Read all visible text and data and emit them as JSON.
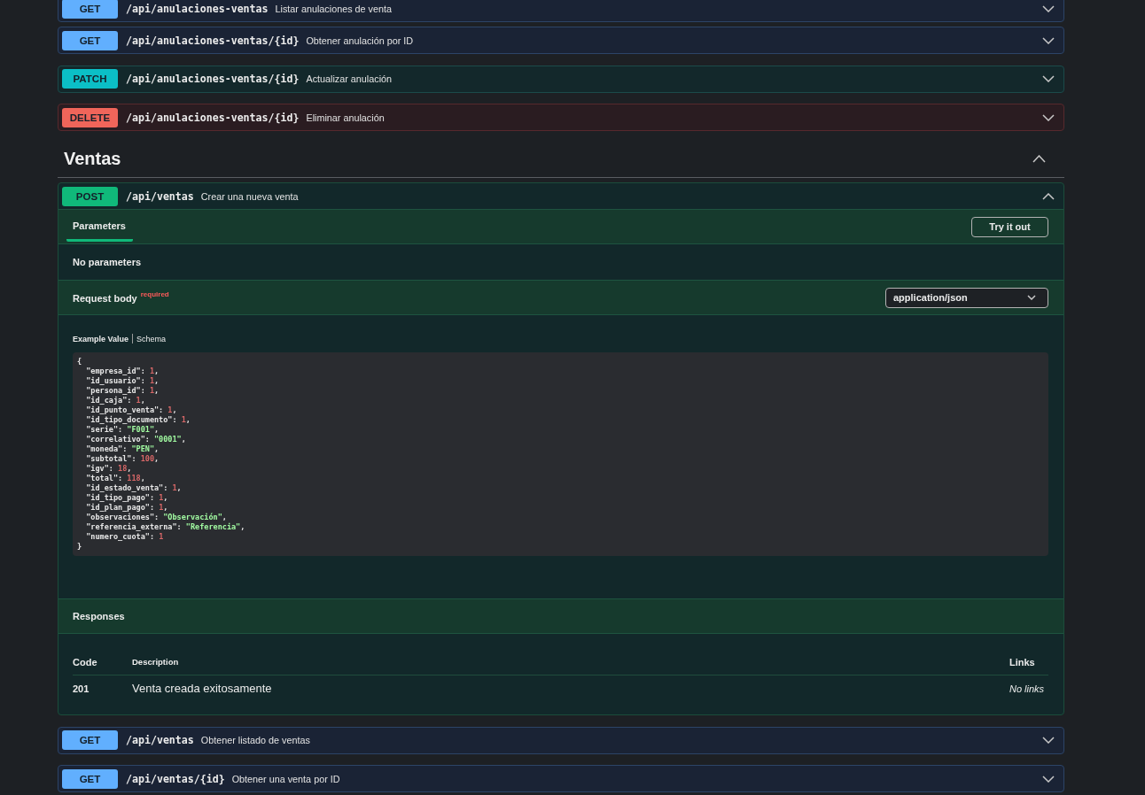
{
  "endpoints_above": [
    {
      "kind": "get",
      "method": "GET",
      "path": "/api/anulaciones-ventas",
      "summary": "Listar anulaciones de venta",
      "expanded": false
    },
    {
      "kind": "get",
      "method": "GET",
      "path": "/api/anulaciones-ventas/{id}",
      "summary": "Obtener anulación por ID",
      "expanded": false
    },
    {
      "kind": "patch",
      "method": "PATCH",
      "path": "/api/anulaciones-ventas/{id}",
      "summary": "Actualizar anulación",
      "expanded": false
    },
    {
      "kind": "delete",
      "method": "DELETE",
      "path": "/api/anulaciones-ventas/{id}",
      "summary": "Eliminar anulación",
      "expanded": false
    }
  ],
  "section": {
    "title": "Ventas",
    "expanded": true
  },
  "endpoints": [
    {
      "kind": "post",
      "method": "POST",
      "path": "/api/ventas",
      "summary": "Crear una nueva venta",
      "expanded": true,
      "details": {
        "parameters_tab": {
          "label": "Parameters",
          "selected": true
        },
        "try_it_out": "Try it out",
        "no_parameters": "No parameters",
        "request_body": {
          "label": "Request body",
          "required": "required",
          "content_type": "application/json"
        },
        "example_tabs": [
          {
            "label": "Example Value",
            "selected": true
          },
          {
            "label": "Schema",
            "selected": false
          }
        ],
        "example_lines": [
          [
            {
              "text": "{",
              "kind": "plain"
            }
          ],
          [
            {
              "text": "  \"empresa_id\": ",
              "kind": "plain"
            },
            {
              "text": "1",
              "kind": "number"
            },
            {
              "text": ",",
              "kind": "plain"
            }
          ],
          [
            {
              "text": "  \"id_usuario\": ",
              "kind": "plain"
            },
            {
              "text": "1",
              "kind": "number"
            },
            {
              "text": ",",
              "kind": "plain"
            }
          ],
          [
            {
              "text": "  \"persona_id\": ",
              "kind": "plain"
            },
            {
              "text": "1",
              "kind": "number"
            },
            {
              "text": ",",
              "kind": "plain"
            }
          ],
          [
            {
              "text": "  \"id_caja\": ",
              "kind": "plain"
            },
            {
              "text": "1",
              "kind": "number"
            },
            {
              "text": ",",
              "kind": "plain"
            }
          ],
          [
            {
              "text": "  \"id_punto_venta\": ",
              "kind": "plain"
            },
            {
              "text": "1",
              "kind": "number"
            },
            {
              "text": ",",
              "kind": "plain"
            }
          ],
          [
            {
              "text": "  \"id_tipo_documento\": ",
              "kind": "plain"
            },
            {
              "text": "1",
              "kind": "number"
            },
            {
              "text": ",",
              "kind": "plain"
            }
          ],
          [
            {
              "text": "  \"serie\": ",
              "kind": "plain"
            },
            {
              "text": "\"F001\"",
              "kind": "string"
            },
            {
              "text": ",",
              "kind": "plain"
            }
          ],
          [
            {
              "text": "  \"correlativo\": ",
              "kind": "plain"
            },
            {
              "text": "\"0001\"",
              "kind": "string"
            },
            {
              "text": ",",
              "kind": "plain"
            }
          ],
          [
            {
              "text": "  \"moneda\": ",
              "kind": "plain"
            },
            {
              "text": "\"PEN\"",
              "kind": "string"
            },
            {
              "text": ",",
              "kind": "plain"
            }
          ],
          [
            {
              "text": "  \"subtotal\": ",
              "kind": "plain"
            },
            {
              "text": "100",
              "kind": "number"
            },
            {
              "text": ",",
              "kind": "plain"
            }
          ],
          [
            {
              "text": "  \"igv\": ",
              "kind": "plain"
            },
            {
              "text": "18",
              "kind": "number"
            },
            {
              "text": ",",
              "kind": "plain"
            }
          ],
          [
            {
              "text": "  \"total\": ",
              "kind": "plain"
            },
            {
              "text": "118",
              "kind": "number"
            },
            {
              "text": ",",
              "kind": "plain"
            }
          ],
          [
            {
              "text": "  \"id_estado_venta\": ",
              "kind": "plain"
            },
            {
              "text": "1",
              "kind": "number"
            },
            {
              "text": ",",
              "kind": "plain"
            }
          ],
          [
            {
              "text": "  \"id_tipo_pago\": ",
              "kind": "plain"
            },
            {
              "text": "1",
              "kind": "number"
            },
            {
              "text": ",",
              "kind": "plain"
            }
          ],
          [
            {
              "text": "  \"id_plan_pago\": ",
              "kind": "plain"
            },
            {
              "text": "1",
              "kind": "number"
            },
            {
              "text": ",",
              "kind": "plain"
            }
          ],
          [
            {
              "text": "  \"observaciones\": ",
              "kind": "plain"
            },
            {
              "text": "\"Observación\"",
              "kind": "string"
            },
            {
              "text": ",",
              "kind": "plain"
            }
          ],
          [
            {
              "text": "  \"referencia_externa\": ",
              "kind": "plain"
            },
            {
              "text": "\"Referencia\"",
              "kind": "string"
            },
            {
              "text": ",",
              "kind": "plain"
            }
          ],
          [
            {
              "text": "  \"numero_cuota\": ",
              "kind": "plain"
            },
            {
              "text": "1",
              "kind": "number"
            }
          ],
          [
            {
              "text": "}",
              "kind": "plain"
            }
          ]
        ],
        "responses": {
          "title": "Responses",
          "columns": [
            "Code",
            "Description",
            "Links"
          ],
          "rows": [
            {
              "code": "201",
              "description": "Venta creada exitosamente",
              "links": "No links"
            }
          ]
        }
      }
    },
    {
      "kind": "get",
      "method": "GET",
      "path": "/api/ventas",
      "summary": "Obtener listado de ventas",
      "expanded": false
    },
    {
      "kind": "get",
      "method": "GET",
      "path": "/api/ventas/{id}",
      "summary": "Obtener una venta por ID",
      "expanded": false
    }
  ]
}
